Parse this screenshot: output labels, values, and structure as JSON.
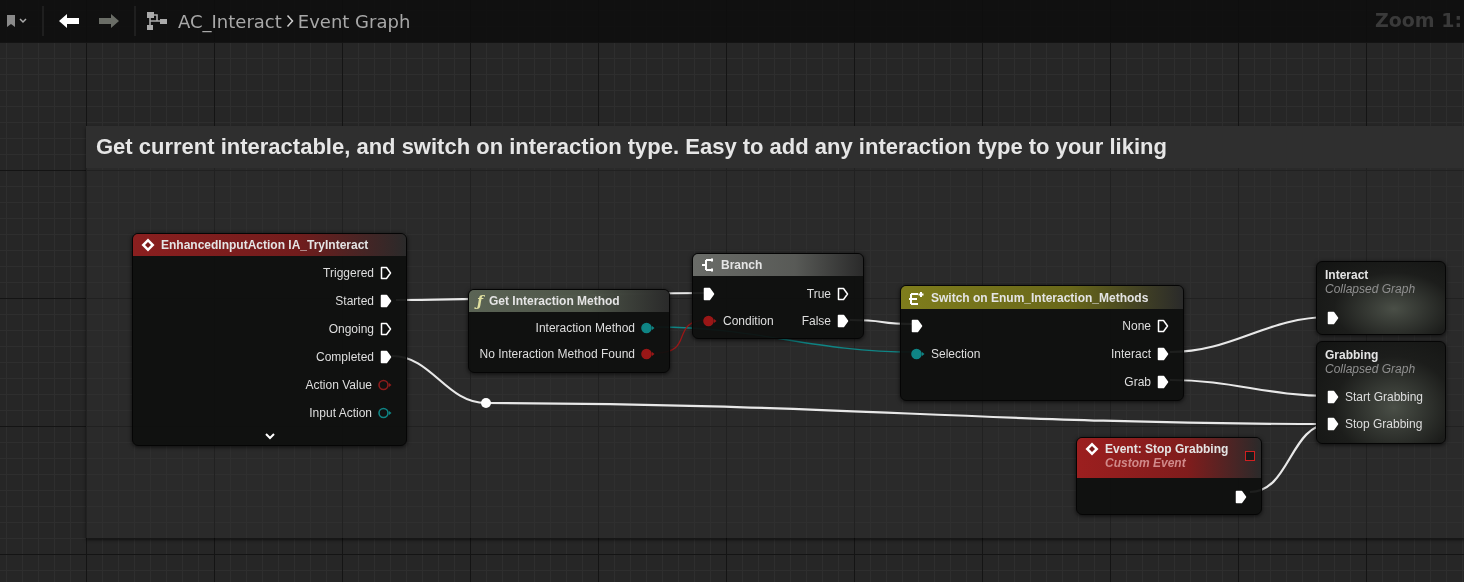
{
  "toolbar": {
    "back_enabled": true,
    "forward_enabled": false,
    "breadcrumbs": [
      "AC_Interact",
      "Event Graph"
    ],
    "zoom_label": "Zoom 1:"
  },
  "comment": {
    "title": "Get current interactable, and switch on interaction type. Easy to add any interaction type to your liking"
  },
  "nodes": [
    {
      "kind": "event",
      "color": "#8a1f1f",
      "title": "EnhancedInputAction IA_TryInteract",
      "expander": true,
      "outputs": [
        {
          "kind": "exec",
          "label": "Triggered",
          "connected": false
        },
        {
          "kind": "exec",
          "label": "Started",
          "connected": true
        },
        {
          "kind": "exec",
          "label": "Ongoing",
          "connected": false
        },
        {
          "kind": "exec",
          "label": "Completed",
          "connected": true
        },
        {
          "kind": "data",
          "label": "Action Value",
          "connected": false,
          "color": "#8c1c1c"
        },
        {
          "kind": "data",
          "label": "Input Action",
          "connected": false,
          "color": "#0f8585"
        }
      ]
    },
    {
      "kind": "function",
      "color": "#5b6455",
      "icon": "ƒ",
      "title": "Get Interaction Method",
      "outputs": [
        {
          "kind": "data",
          "label": "Interaction Method",
          "connected": true,
          "color": "#0f8585"
        },
        {
          "kind": "data",
          "label": "No Interaction Method Found",
          "connected": true,
          "color": "#9a1717"
        }
      ]
    },
    {
      "kind": "branch",
      "color": "#6a6c68",
      "title": "Branch",
      "inputs": [
        {
          "kind": "exec",
          "connected": true
        },
        {
          "kind": "data",
          "label": "Condition",
          "connected": true,
          "color": "#9a1717"
        }
      ],
      "outputs": [
        {
          "kind": "exec",
          "label": "True",
          "connected": false
        },
        {
          "kind": "exec",
          "label": "False",
          "connected": true
        }
      ]
    },
    {
      "kind": "switch",
      "color": "#7f7d1c",
      "title": "Switch on Enum_Interaction_Methods",
      "inputs": [
        {
          "kind": "exec",
          "connected": true
        },
        {
          "kind": "data",
          "label": "Selection",
          "connected": true,
          "color": "#0f8585"
        }
      ],
      "outputs": [
        {
          "kind": "exec",
          "label": "None",
          "connected": false
        },
        {
          "kind": "exec",
          "label": "Interact",
          "connected": true
        },
        {
          "kind": "exec",
          "label": "Grab",
          "connected": true
        }
      ]
    },
    {
      "kind": "collapsed",
      "title": "Interact",
      "subtitle": "Collapsed Graph",
      "inputs": [
        {
          "kind": "exec",
          "connected": true
        }
      ]
    },
    {
      "kind": "collapsed",
      "title": "Grabbing",
      "subtitle": "Collapsed Graph",
      "inputs": [
        {
          "kind": "exec",
          "label": "Start Grabbing",
          "connected": true
        },
        {
          "kind": "exec",
          "label": "Stop Grabbing",
          "connected": true
        }
      ]
    },
    {
      "kind": "custom_event",
      "color": "#9c1f1f",
      "title": "Event: Stop Grabbing",
      "subtitle": "Custom Event",
      "outputs": [
        {
          "kind": "exec",
          "connected": true
        }
      ]
    }
  ]
}
